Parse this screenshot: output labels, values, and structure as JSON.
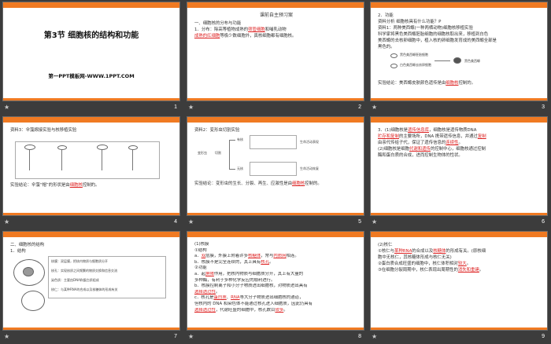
{
  "colors": {
    "accent": "#f07a22",
    "highlight": "#d22222",
    "background": "#3c3c3c"
  },
  "thumb_icon": "star-icon",
  "slides": [
    {
      "num": "1",
      "title": "第3节  细胞核的结构和功能",
      "subtitle": "第一PPT模板网-WWW.1PPT.COM"
    },
    {
      "num": "2",
      "header": "课前自主预习案",
      "l1": "一、细胞核的分布与功能",
      "l2a": "1．分布：除高等植物成熟的",
      "l2b": "筛管细胞",
      "l2c": "和哺乳动物",
      "l3a": "成熟的红细胞",
      "l3b": "等极少数细胞外，真核细胞都有细胞核。"
    },
    {
      "num": "3",
      "l1": "2．功能",
      "l2": "资料分析   细胞核具有什么功能？P",
      "l3": "资料1：两种美西螈(一种两栖动物)细胞核移植实验",
      "l4": "科学家将黑色美西螈胚胎细胞的细胞核取出来，移植到白色",
      "l5": "美西螈的去核卵细胞中，植入核的卵细胞发育成的美西螈全部是",
      "l6": "黑色的。",
      "d1": "黑色美西螈胚胎细胞",
      "d2": "白色美西螈去核卵细胞",
      "d3": "黑色美西螈",
      "l7a": "实验结论：美西螈皮肤颜色遗传是由",
      "l7b": "细胞核",
      "l7c": "控制的。"
    },
    {
      "num": "4",
      "l1": "资料3：伞藻嫁接实验与核移植实验",
      "l2a": "实验结论：伞藻“帽”的形状是由",
      "l2b": "细胞核",
      "l2c": "控制的。"
    },
    {
      "num": "5",
      "l1": "资料2：变形虫切割实验",
      "d1": "变形虫",
      "d2": "切割",
      "d3": "有核",
      "d4": "无核",
      "d5": "生命活动表现",
      "d6": "生命活动恢复",
      "l2a": "实验结论：变形虫的生长、分裂、再生、应激性是由",
      "l2b": "细胞核",
      "l2c": "控制的。"
    },
    {
      "num": "6",
      "l1a": "3．(1)细胞核是",
      "l1b": "遗传信息库",
      "l1c": "，细胞核是遗传物质DNA",
      "l2a": "贮存和复制",
      "l2b": "的主要场所，DNA 携带遗传信息，并通过",
      "l2c": "复制",
      "l3a": "由亲代传给子代，保证了遗传信息的",
      "l3b": "连续性",
      "l3c": "。",
      "l4a": "(2)细胞核是细胞",
      "l4b": "代谢和遗传",
      "l4c": "的控制中心，细胞核通过控制",
      "l5": "酶和蛋白质的合成，进而控制生物体的性状。"
    },
    {
      "num": "7",
      "l1": "二、细胞核的结构",
      "l2": "1．结构",
      "d1": "核膜：双层膜，把核内物质与细胞质分开",
      "d2": "核孔：实现核质之间频繁的物质交换和信息交流",
      "d3": "染色质：主要由DNA和蛋白质组成",
      "d4": "核仁：与某种RNA的合成以及核糖体的形成有关"
    },
    {
      "num": "8",
      "l1": "(1)核膜",
      "l2": "①结构",
      "l3a": "a．",
      "l3b": "双",
      "l3c": "层膜，外膜上附着许多",
      "l3d": "核糖体",
      "l3e": "，常与",
      "l3f": "内质网",
      "l3g": "相连。",
      "l4a": "b．核膜不是完全连续的，其上具有",
      "l4b": "核孔",
      "l4c": "。",
      "l5": "②功能",
      "l6a": "a．起",
      "l6b": "屏障",
      "l6c": "作用，把核内物质与细胞质分开，其上有大量的",
      "l7": "多种酶，有利于多种化学反应的顺利进行。",
      "l8": "b．核膜控制离子和小分子物质进出细胞核，对物质进出具有",
      "l9a": "",
      "l9b": "选择透过性",
      "l9c": "。",
      "l10a": "c．核孔是",
      "l10b": "蛋白质",
      "l10c": "、",
      "l10d": "RNA",
      "l10e": "等大分子物质进出细胞核的通道，",
      "l11": "但核内的 DNA 和染色体不能通过核孔进入细胞质，因此仍具有",
      "l12a": "选择透过性",
      "l12b": "，代谢旺盛的细胞中，核孔数目",
      "l12c": "较多",
      "l12d": "。"
    },
    {
      "num": "9",
      "l1": "(2)核仁",
      "l2a": "①核仁与",
      "l2b": "某种RNA",
      "l2c": "的合成以及",
      "l2d": "核糖体",
      "l2e": "的形成有关。(原核细",
      "l3": "胞中无核仁，其核糖体形成与核仁无关)",
      "l4a": "②蛋白质合成旺盛的细胞中，核仁体积相对",
      "l4b": "较大",
      "l4c": "。",
      "l5a": "③在细胞分裂周期中，核仁表现出周期性的",
      "l5b": "消失和重建",
      "l5c": "。"
    }
  ]
}
